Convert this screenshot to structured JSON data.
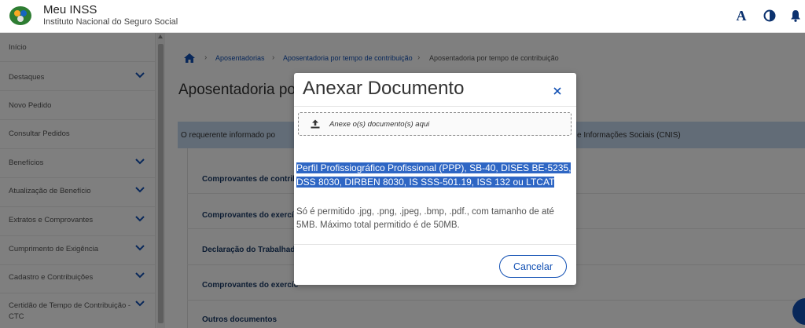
{
  "header": {
    "title": "Meu INSS",
    "subtitle": "Instituto Nacional do Seguro Social",
    "font_size_label": "A"
  },
  "sidebar": {
    "items": [
      {
        "label": "Início",
        "has_chevron": false
      },
      {
        "label": "Destaques",
        "has_chevron": true
      },
      {
        "label": "Novo Pedido",
        "has_chevron": false
      },
      {
        "label": "Consultar Pedidos",
        "has_chevron": false
      },
      {
        "label": "Benefícios",
        "has_chevron": true
      },
      {
        "label": "Atualização de Benefício",
        "has_chevron": true
      },
      {
        "label": "Extratos e Comprovantes",
        "has_chevron": true
      },
      {
        "label": "Cumprimento de Exigência",
        "has_chevron": true
      },
      {
        "label": "Cadastro e Contribuições",
        "has_chevron": true
      },
      {
        "label": "Certidão de Tempo de Contribuição - CTC",
        "line1": "Certidão de Tempo de Contribuição -",
        "line2": "CTC",
        "has_chevron": true
      }
    ]
  },
  "breadcrumb": [
    "Aposentadorias",
    "Aposentadoria por tempo de contribuição",
    "Aposentadoria por tempo de contribuição"
  ],
  "page": {
    "title": "Aposentadoria po",
    "info_left": "O requerente informado po",
    "info_right": "e Informações Sociais (CNIS)"
  },
  "documents": [
    "Comprovantes de contrib",
    "Comprovantes do exercíc",
    "Declaração do Trabalhad",
    "Comprovantes do exercíc",
    "Outros documentos"
  ],
  "modal": {
    "title": "Anexar Documento",
    "upload_label": "Anexe o(s) documento(s) aqui",
    "doc_type_line1": "Perfil Profissiográfico Profissional (PPP), SB-40, DISES BE-5235,",
    "doc_type_line2": "DSS 8030, DIRBEN 8030, IS SSS-501.19, ISS 132 ou LTCAT",
    "allowed_text": "Só é permitido .jpg, .png, .jpeg, .bmp, .pdf., com tamanho de até 5MB. Máximo total permitido é de 50MB.",
    "cancel_label": "Cancelar"
  },
  "colors": {
    "primary": "#1351b4",
    "selection": "#2e66c4",
    "banner": "#c5d8ee",
    "header_icon": "#0c326f"
  }
}
